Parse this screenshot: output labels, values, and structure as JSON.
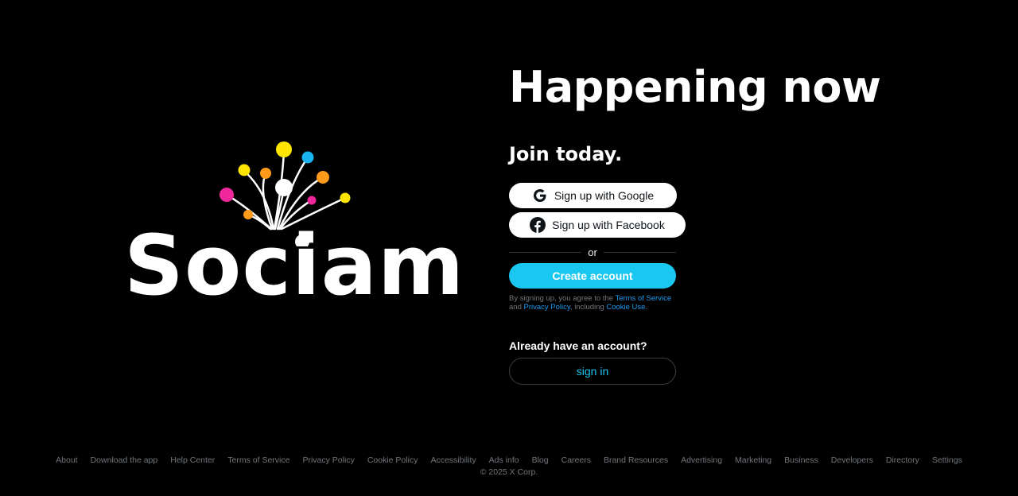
{
  "brand": {
    "name": "Sociam",
    "dot_colors": {
      "yellow": "#ffe600",
      "blue": "#1ab4f0",
      "orange": "#ff9a1a",
      "pink": "#f0269b",
      "white": "#ffffff"
    }
  },
  "hero": {
    "headline": "Happening now",
    "join_title": "Join today."
  },
  "signup": {
    "google_label": "Sign up with Google",
    "facebook_label": "Sign up with Facebook",
    "or_label": "or",
    "create_label": "Create account",
    "legal": {
      "prefix": "By signing up, you agree to the ",
      "terms": "Terms of Service",
      "and": "and ",
      "privacy": "Privacy Policy",
      "including": ", including ",
      "cookie": "Cookie Use."
    }
  },
  "signin": {
    "prompt": "Already have an account?",
    "label": "sign in"
  },
  "footer": {
    "links": [
      "About",
      "Download the app",
      "Help Center",
      "Terms of Service",
      "Privacy Policy",
      "Cookie Policy",
      "Accessibility",
      "Ads info",
      "Blog",
      "Careers",
      "Brand Resources",
      "Advertising",
      "Marketing",
      "Business",
      "Developers",
      "Directory",
      "Settings"
    ],
    "copyright": "© 2025 X Corp."
  },
  "colors": {
    "accent": "#1ac7f0",
    "link": "#1d9bf0",
    "muted": "#71767b",
    "background": "#000000"
  }
}
